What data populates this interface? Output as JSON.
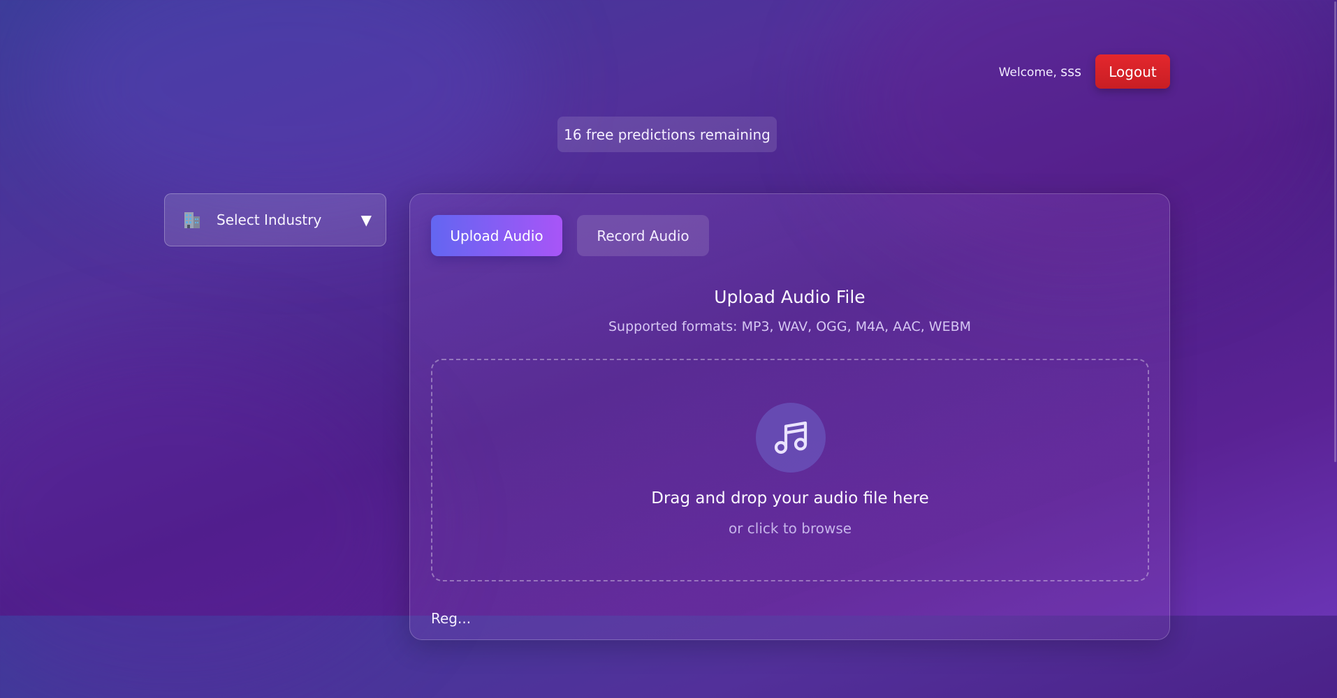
{
  "header": {
    "welcome_prefix": "Welcome,",
    "username": "sss",
    "logout_label": "Logout"
  },
  "credits": {
    "text": "16 free predictions remaining"
  },
  "industry_select": {
    "icon": "office-building-icon",
    "label": "Select Industry",
    "arrow": "▼"
  },
  "main": {
    "tabs": [
      {
        "label": "Upload Audio",
        "active": true
      },
      {
        "label": "Record Audio",
        "active": false
      }
    ],
    "title": "Upload Audio File",
    "formats": "Supported formats: MP3, WAV, OGG, M4A, AAC, WEBM",
    "dropzone": {
      "icon": "music-note-icon",
      "title": "Drag and drop your audio file here",
      "subtitle": "or click to browse"
    },
    "next_section_peek": "Reg..."
  },
  "colors": {
    "logout": "#dc2626",
    "tab_active_start": "#6366f1",
    "tab_active_end": "#a855f7"
  }
}
